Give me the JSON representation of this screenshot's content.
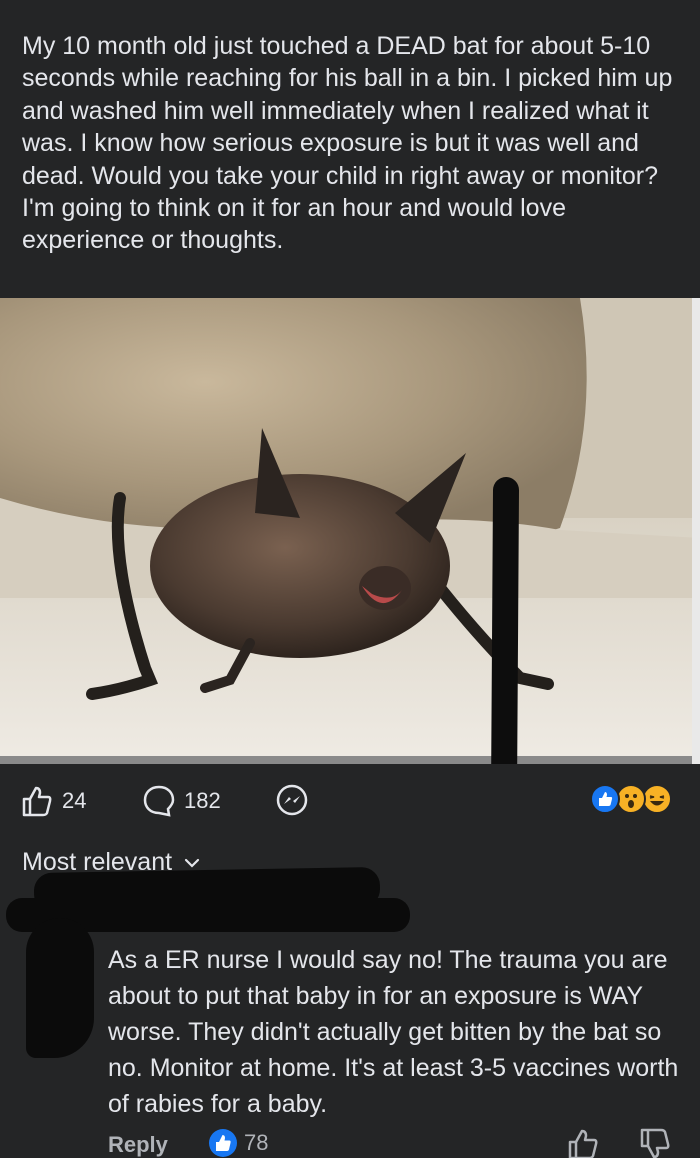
{
  "post": {
    "text": "My 10 month old just touched a DEAD bat for about 5-10 seconds while reaching for his ball in a bin.  I picked him up and washed him well immediately when I realized what it was. I know how serious exposure is but it was well and dead. Would you take your child in right away or monitor? I'm going to think on it for an hour and would love experience or thoughts."
  },
  "actions": {
    "like_count": "24",
    "comment_count": "182",
    "reactions": [
      "like",
      "wow",
      "haha"
    ]
  },
  "comments_section": {
    "sort_label": "Most relevant"
  },
  "comment": {
    "text": "As a ER nurse I would say no! The trauma you are about to put that baby in for an exposure is WAY worse. They didn't actually get bitten by the bat so no. Monitor at home. It's at least 3-5 vaccines worth of rabies for a baby.",
    "reply_label": "Reply",
    "like_count": "78"
  },
  "colors": {
    "background": "#242526",
    "text": "#e4e6eb",
    "secondary_text": "#b0b3b8",
    "like_blue": "#1877f2",
    "reaction_yellow": "#f7b125"
  }
}
